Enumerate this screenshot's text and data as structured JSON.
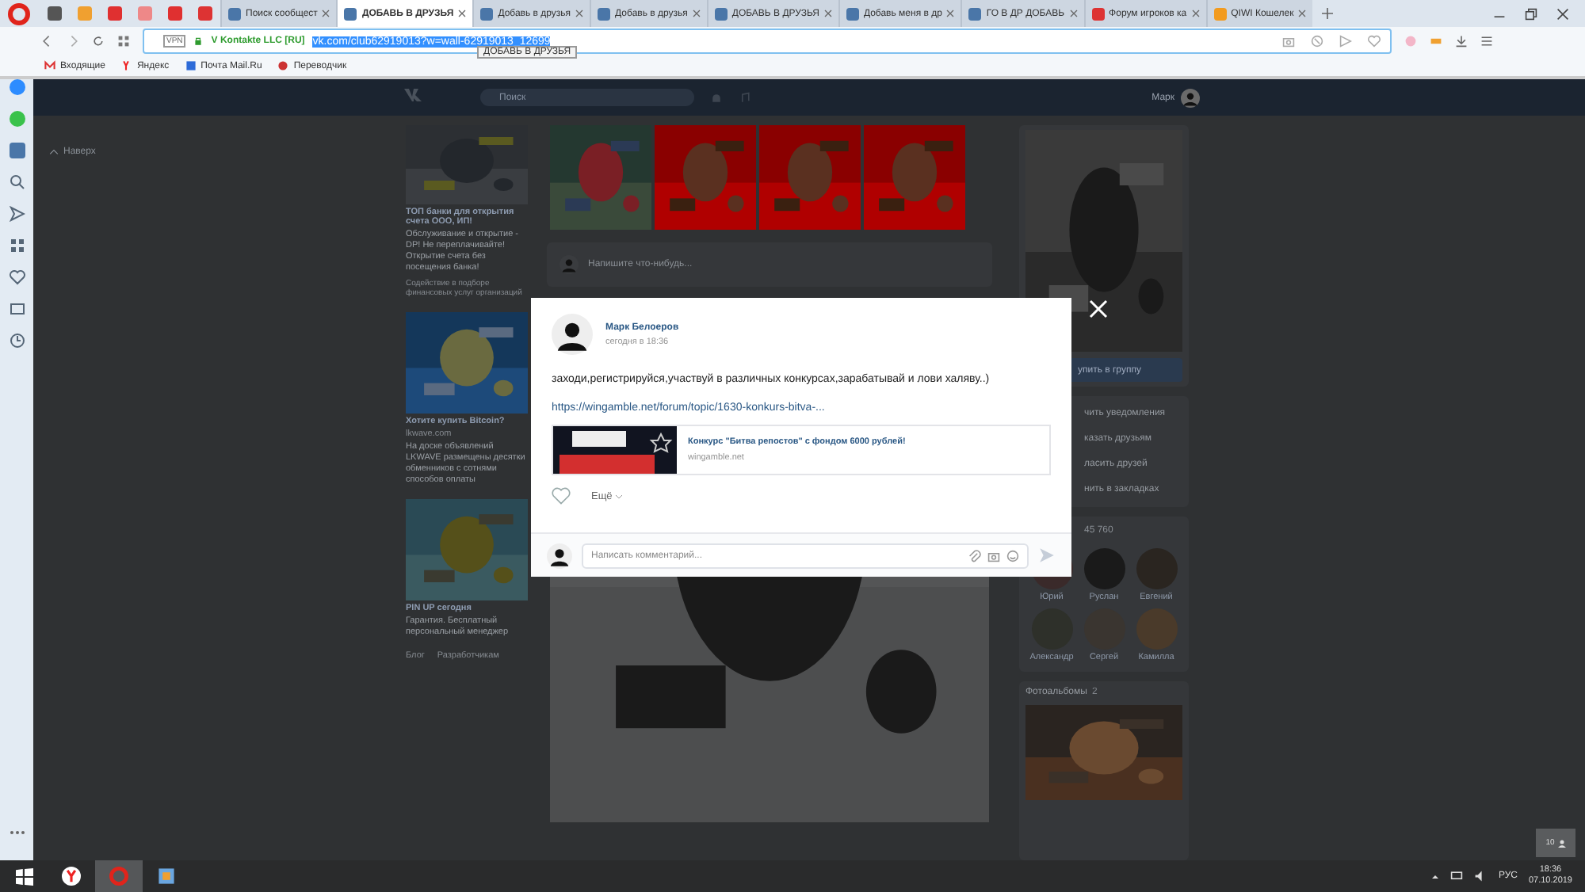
{
  "browser": {
    "pinned": [
      {
        "kind": "doc"
      },
      {
        "kind": "mb"
      },
      {
        "kind": "red"
      },
      {
        "kind": "apple"
      },
      {
        "kind": "red"
      },
      {
        "kind": "w"
      }
    ],
    "tabs": [
      {
        "title": "Поиск сообщест",
        "selected": false,
        "kind": "vk"
      },
      {
        "title": "ДОБАВЬ В ДРУЗЬЯ",
        "selected": true,
        "kind": "vk"
      },
      {
        "title": "Добавь в друзья",
        "selected": false,
        "kind": "vk"
      },
      {
        "title": "Добавь в друзья",
        "selected": false,
        "kind": "vk"
      },
      {
        "title": "ДОБАВЬ В ДРУЗЬЯ",
        "selected": false,
        "kind": "vk"
      },
      {
        "title": "Добавь меня в др",
        "selected": false,
        "kind": "vk"
      },
      {
        "title": "ГО В ДР ДОБАВЬ",
        "selected": false,
        "kind": "vk"
      },
      {
        "title": "Форум игроков ка",
        "selected": false,
        "kind": "w"
      },
      {
        "title": "QIWI Кошелек",
        "selected": false,
        "kind": "qiwi"
      }
    ],
    "address": {
      "vpn": "VPN",
      "company": "V Kontakte LLC [RU]",
      "url": "vk.com/club62919013?w=wall-62919013_12699"
    },
    "tooltip": "ДОБАВЬ В ДРУЗЬЯ",
    "bookmarks": [
      {
        "label": "Входящие",
        "kind": "gmail"
      },
      {
        "label": "Яндекс",
        "kind": "yandex"
      },
      {
        "label": "Почта Mail.Ru",
        "kind": "mail"
      },
      {
        "label": "Переводчик",
        "kind": "translate"
      }
    ]
  },
  "vk_header": {
    "search_placeholder": "Поиск",
    "user": "Марк"
  },
  "back_to_top": "Наверх",
  "ads": [
    {
      "title": "ТОП банки для открытия счета ООО, ИП!",
      "text": "Обслуживание и открытие - DP! Не переплачивайте! Открытие счета без посещения банка!",
      "note": "Содействие в подборе финансовых услуг организаций",
      "kind": "devices"
    },
    {
      "title": "Хотите купить Bitcoin?",
      "domain": "lkwave.com",
      "text": "На доске объявлений LKWAVE размещены десятки обменников с сотнями способов оплаты",
      "kind": "cart"
    },
    {
      "title": "PIN UP сегодня",
      "text": "Гарантия. Бесплатный персональный менеджер",
      "kind": "money"
    }
  ],
  "footer_links": [
    "Блог",
    "Разработчикам"
  ],
  "wall": {
    "composer_placeholder": "Напишите что-нибудь..."
  },
  "group": {
    "join_button": "упить в группу",
    "actions": [
      "чить уведомления",
      "казать друзьям",
      "ласить друзей",
      "нить в закладках"
    ],
    "followers_count": "45 760",
    "followers": [
      "Юрий",
      "Руслан",
      "Евгений",
      "Александр",
      "Сергей",
      "Камилла"
    ],
    "albums_title": "Фотоальбомы",
    "albums_count": "2"
  },
  "post_modal": {
    "author": "Марк Белоеров",
    "time": "сегодня в 18:36",
    "text": "заходи,регистрируйся,участвуй в различных конкурсах,зарабатывай и лови халяву..)",
    "link": "https://wingamble.net/forum/topic/1630-konkurs-bitva-...",
    "preview": {
      "title": "Конкурс \"Битва репостов\" с фондом 6000 рублей!",
      "domain": "wingamble.net"
    },
    "more": "Ещё",
    "comment_placeholder": "Написать комментарий..."
  },
  "notification_badge": "10",
  "taskbar": {
    "apps": [
      {
        "kind": "yandex",
        "selected": false
      },
      {
        "kind": "opera",
        "selected": true
      },
      {
        "kind": "editor",
        "selected": false
      }
    ],
    "language": "РУС",
    "time": "18:36",
    "date": "07.10.2019"
  }
}
